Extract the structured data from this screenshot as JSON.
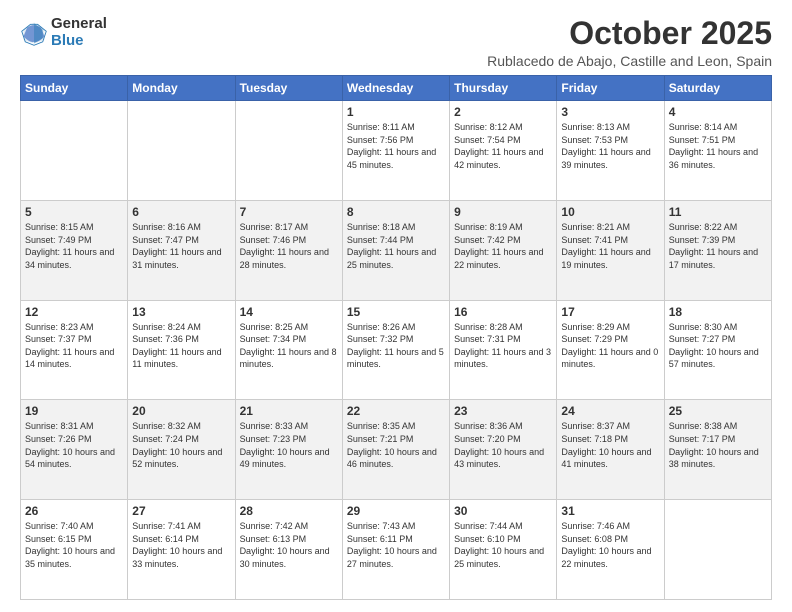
{
  "header": {
    "logo_general": "General",
    "logo_blue": "Blue",
    "month_title": "October 2025",
    "subtitle": "Rublacedo de Abajo, Castille and Leon, Spain"
  },
  "days_of_week": [
    "Sunday",
    "Monday",
    "Tuesday",
    "Wednesday",
    "Thursday",
    "Friday",
    "Saturday"
  ],
  "weeks": [
    [
      {
        "day": "",
        "info": ""
      },
      {
        "day": "",
        "info": ""
      },
      {
        "day": "",
        "info": ""
      },
      {
        "day": "1",
        "info": "Sunrise: 8:11 AM\nSunset: 7:56 PM\nDaylight: 11 hours and 45 minutes."
      },
      {
        "day": "2",
        "info": "Sunrise: 8:12 AM\nSunset: 7:54 PM\nDaylight: 11 hours and 42 minutes."
      },
      {
        "day": "3",
        "info": "Sunrise: 8:13 AM\nSunset: 7:53 PM\nDaylight: 11 hours and 39 minutes."
      },
      {
        "day": "4",
        "info": "Sunrise: 8:14 AM\nSunset: 7:51 PM\nDaylight: 11 hours and 36 minutes."
      }
    ],
    [
      {
        "day": "5",
        "info": "Sunrise: 8:15 AM\nSunset: 7:49 PM\nDaylight: 11 hours and 34 minutes."
      },
      {
        "day": "6",
        "info": "Sunrise: 8:16 AM\nSunset: 7:47 PM\nDaylight: 11 hours and 31 minutes."
      },
      {
        "day": "7",
        "info": "Sunrise: 8:17 AM\nSunset: 7:46 PM\nDaylight: 11 hours and 28 minutes."
      },
      {
        "day": "8",
        "info": "Sunrise: 8:18 AM\nSunset: 7:44 PM\nDaylight: 11 hours and 25 minutes."
      },
      {
        "day": "9",
        "info": "Sunrise: 8:19 AM\nSunset: 7:42 PM\nDaylight: 11 hours and 22 minutes."
      },
      {
        "day": "10",
        "info": "Sunrise: 8:21 AM\nSunset: 7:41 PM\nDaylight: 11 hours and 19 minutes."
      },
      {
        "day": "11",
        "info": "Sunrise: 8:22 AM\nSunset: 7:39 PM\nDaylight: 11 hours and 17 minutes."
      }
    ],
    [
      {
        "day": "12",
        "info": "Sunrise: 8:23 AM\nSunset: 7:37 PM\nDaylight: 11 hours and 14 minutes."
      },
      {
        "day": "13",
        "info": "Sunrise: 8:24 AM\nSunset: 7:36 PM\nDaylight: 11 hours and 11 minutes."
      },
      {
        "day": "14",
        "info": "Sunrise: 8:25 AM\nSunset: 7:34 PM\nDaylight: 11 hours and 8 minutes."
      },
      {
        "day": "15",
        "info": "Sunrise: 8:26 AM\nSunset: 7:32 PM\nDaylight: 11 hours and 5 minutes."
      },
      {
        "day": "16",
        "info": "Sunrise: 8:28 AM\nSunset: 7:31 PM\nDaylight: 11 hours and 3 minutes."
      },
      {
        "day": "17",
        "info": "Sunrise: 8:29 AM\nSunset: 7:29 PM\nDaylight: 11 hours and 0 minutes."
      },
      {
        "day": "18",
        "info": "Sunrise: 8:30 AM\nSunset: 7:27 PM\nDaylight: 10 hours and 57 minutes."
      }
    ],
    [
      {
        "day": "19",
        "info": "Sunrise: 8:31 AM\nSunset: 7:26 PM\nDaylight: 10 hours and 54 minutes."
      },
      {
        "day": "20",
        "info": "Sunrise: 8:32 AM\nSunset: 7:24 PM\nDaylight: 10 hours and 52 minutes."
      },
      {
        "day": "21",
        "info": "Sunrise: 8:33 AM\nSunset: 7:23 PM\nDaylight: 10 hours and 49 minutes."
      },
      {
        "day": "22",
        "info": "Sunrise: 8:35 AM\nSunset: 7:21 PM\nDaylight: 10 hours and 46 minutes."
      },
      {
        "day": "23",
        "info": "Sunrise: 8:36 AM\nSunset: 7:20 PM\nDaylight: 10 hours and 43 minutes."
      },
      {
        "day": "24",
        "info": "Sunrise: 8:37 AM\nSunset: 7:18 PM\nDaylight: 10 hours and 41 minutes."
      },
      {
        "day": "25",
        "info": "Sunrise: 8:38 AM\nSunset: 7:17 PM\nDaylight: 10 hours and 38 minutes."
      }
    ],
    [
      {
        "day": "26",
        "info": "Sunrise: 7:40 AM\nSunset: 6:15 PM\nDaylight: 10 hours and 35 minutes."
      },
      {
        "day": "27",
        "info": "Sunrise: 7:41 AM\nSunset: 6:14 PM\nDaylight: 10 hours and 33 minutes."
      },
      {
        "day": "28",
        "info": "Sunrise: 7:42 AM\nSunset: 6:13 PM\nDaylight: 10 hours and 30 minutes."
      },
      {
        "day": "29",
        "info": "Sunrise: 7:43 AM\nSunset: 6:11 PM\nDaylight: 10 hours and 27 minutes."
      },
      {
        "day": "30",
        "info": "Sunrise: 7:44 AM\nSunset: 6:10 PM\nDaylight: 10 hours and 25 minutes."
      },
      {
        "day": "31",
        "info": "Sunrise: 7:46 AM\nSunset: 6:08 PM\nDaylight: 10 hours and 22 minutes."
      },
      {
        "day": "",
        "info": ""
      }
    ]
  ]
}
